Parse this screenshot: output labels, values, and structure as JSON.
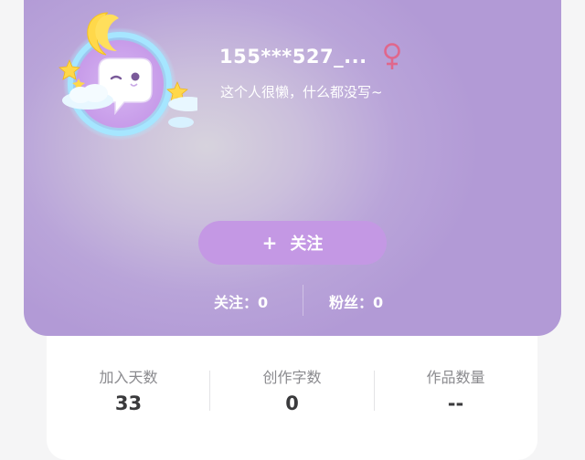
{
  "profile": {
    "username": "155***527_...",
    "gender": "female",
    "bio": "这个人很懒，什么都没写~",
    "avatar_icon": "moon-chat-bubble-avatar-icon"
  },
  "actions": {
    "follow_plus": "+",
    "follow_label": "关注"
  },
  "social": {
    "following": "关注：0",
    "fans": "粉丝：0"
  },
  "stats": [
    {
      "label": "加入天数",
      "value": "33"
    },
    {
      "label": "创作字数",
      "value": "0"
    },
    {
      "label": "作品数量",
      "value": "--"
    }
  ],
  "colors": {
    "card_purple": "#b29ad6",
    "button_purple": "#c498e4",
    "gender_pink": "#e0678c"
  }
}
